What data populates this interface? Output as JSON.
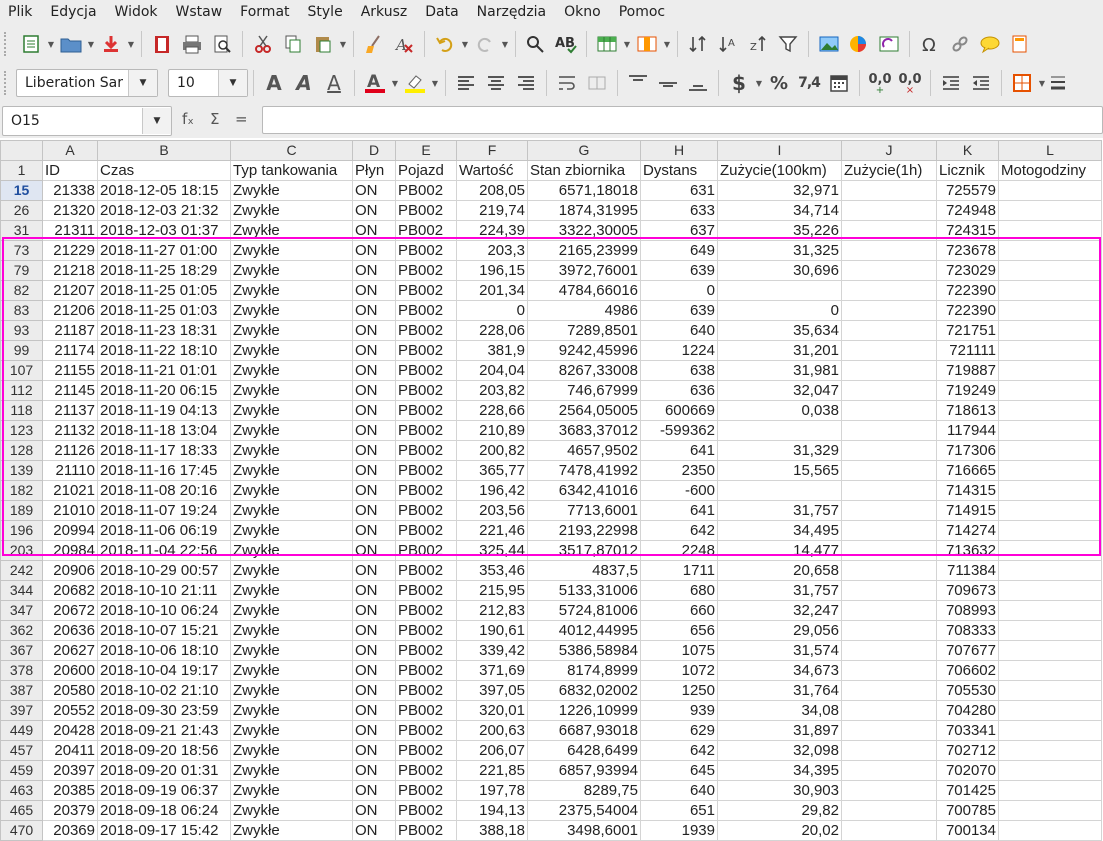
{
  "menu": [
    "Plik",
    "Edycja",
    "Widok",
    "Wstaw",
    "Format",
    "Style",
    "Arkusz",
    "Data",
    "Narzędzia",
    "Okno",
    "Pomoc"
  ],
  "font_name": "Liberation Sar",
  "font_size": "10",
  "name_box": "O15",
  "formula_icons": {
    "fx": "fₓ",
    "sigma": "Σ",
    "eq": "="
  },
  "toolbar_text": {
    "bold": "A",
    "italic": "A",
    "shadow": "A",
    "currency": "$",
    "percent": "%",
    "number": "7,4",
    "add_dec": "0,0",
    "del_dec": "0,0"
  },
  "columns": [
    "A",
    "B",
    "C",
    "D",
    "E",
    "F",
    "G",
    "H",
    "I",
    "J",
    "K",
    "L"
  ],
  "header_row": {
    "num": "1",
    "cells": [
      "ID",
      "Czas",
      "Typ tankowania",
      "Płyn",
      "Pojazd",
      "Wartość",
      "Stan zbiornika",
      "Dystans",
      "Zużycie(100km)",
      "Zużycie(1h)",
      "Licznik",
      "Motogodziny"
    ]
  },
  "rows": [
    {
      "num": "15",
      "cells": [
        "21338",
        "2018-12-05 18:15",
        "Zwykłe",
        "ON",
        "PB002",
        "208,05",
        "6571,18018",
        "631",
        "32,971",
        "",
        "725579",
        ""
      ]
    },
    {
      "num": "26",
      "cells": [
        "21320",
        "2018-12-03 21:32",
        "Zwykłe",
        "ON",
        "PB002",
        "219,74",
        "1874,31995",
        "633",
        "34,714",
        "",
        "724948",
        ""
      ]
    },
    {
      "num": "31",
      "cells": [
        "21311",
        "2018-12-03 01:37",
        "Zwykłe",
        "ON",
        "PB002",
        "224,39",
        "3322,30005",
        "637",
        "35,226",
        "",
        "724315",
        ""
      ]
    },
    {
      "num": "73",
      "cells": [
        "21229",
        "2018-11-27 01:00",
        "Zwykłe",
        "ON",
        "PB002",
        "203,3",
        "2165,23999",
        "649",
        "31,325",
        "",
        "723678",
        ""
      ]
    },
    {
      "num": "79",
      "cells": [
        "21218",
        "2018-11-25 18:29",
        "Zwykłe",
        "ON",
        "PB002",
        "196,15",
        "3972,76001",
        "639",
        "30,696",
        "",
        "723029",
        ""
      ]
    },
    {
      "num": "82",
      "cells": [
        "21207",
        "2018-11-25 01:05",
        "Zwykłe",
        "ON",
        "PB002",
        "201,34",
        "4784,66016",
        "0",
        "",
        "",
        "722390",
        ""
      ]
    },
    {
      "num": "83",
      "cells": [
        "21206",
        "2018-11-25 01:03",
        "Zwykłe",
        "ON",
        "PB002",
        "0",
        "4986",
        "639",
        "0",
        "",
        "722390",
        ""
      ]
    },
    {
      "num": "93",
      "cells": [
        "21187",
        "2018-11-23 18:31",
        "Zwykłe",
        "ON",
        "PB002",
        "228,06",
        "7289,8501",
        "640",
        "35,634",
        "",
        "721751",
        ""
      ]
    },
    {
      "num": "99",
      "cells": [
        "21174",
        "2018-11-22 18:10",
        "Zwykłe",
        "ON",
        "PB002",
        "381,9",
        "9242,45996",
        "1224",
        "31,201",
        "",
        "721111",
        ""
      ]
    },
    {
      "num": "107",
      "cells": [
        "21155",
        "2018-11-21 01:01",
        "Zwykłe",
        "ON",
        "PB002",
        "204,04",
        "8267,33008",
        "638",
        "31,981",
        "",
        "719887",
        ""
      ]
    },
    {
      "num": "112",
      "cells": [
        "21145",
        "2018-11-20 06:15",
        "Zwykłe",
        "ON",
        "PB002",
        "203,82",
        "746,67999",
        "636",
        "32,047",
        "",
        "719249",
        ""
      ]
    },
    {
      "num": "118",
      "cells": [
        "21137",
        "2018-11-19 04:13",
        "Zwykłe",
        "ON",
        "PB002",
        "228,66",
        "2564,05005",
        "600669",
        "0,038",
        "",
        "718613",
        ""
      ]
    },
    {
      "num": "123",
      "cells": [
        "21132",
        "2018-11-18 13:04",
        "Zwykłe",
        "ON",
        "PB002",
        "210,89",
        "3683,37012",
        "-599362",
        "",
        "",
        "117944",
        ""
      ]
    },
    {
      "num": "128",
      "cells": [
        "21126",
        "2018-11-17 18:33",
        "Zwykłe",
        "ON",
        "PB002",
        "200,82",
        "4657,9502",
        "641",
        "31,329",
        "",
        "717306",
        ""
      ]
    },
    {
      "num": "139",
      "cells": [
        "21110",
        "2018-11-16 17:45",
        "Zwykłe",
        "ON",
        "PB002",
        "365,77",
        "7478,41992",
        "2350",
        "15,565",
        "",
        "716665",
        ""
      ]
    },
    {
      "num": "182",
      "cells": [
        "21021",
        "2018-11-08 20:16",
        "Zwykłe",
        "ON",
        "PB002",
        "196,42",
        "6342,41016",
        "-600",
        "",
        "",
        "714315",
        ""
      ]
    },
    {
      "num": "189",
      "cells": [
        "21010",
        "2018-11-07 19:24",
        "Zwykłe",
        "ON",
        "PB002",
        "203,56",
        "7713,6001",
        "641",
        "31,757",
        "",
        "714915",
        ""
      ]
    },
    {
      "num": "196",
      "cells": [
        "20994",
        "2018-11-06 06:19",
        "Zwykłe",
        "ON",
        "PB002",
        "221,46",
        "2193,22998",
        "642",
        "34,495",
        "",
        "714274",
        ""
      ]
    },
    {
      "num": "203",
      "cells": [
        "20984",
        "2018-11-04 22:56",
        "Zwykłe",
        "ON",
        "PB002",
        "325,44",
        "3517,87012",
        "2248",
        "14,477",
        "",
        "713632",
        ""
      ]
    },
    {
      "num": "242",
      "cells": [
        "20906",
        "2018-10-29 00:57",
        "Zwykłe",
        "ON",
        "PB002",
        "353,46",
        "4837,5",
        "1711",
        "20,658",
        "",
        "711384",
        ""
      ]
    },
    {
      "num": "344",
      "cells": [
        "20682",
        "2018-10-10 21:11",
        "Zwykłe",
        "ON",
        "PB002",
        "215,95",
        "5133,31006",
        "680",
        "31,757",
        "",
        "709673",
        ""
      ]
    },
    {
      "num": "347",
      "cells": [
        "20672",
        "2018-10-10 06:24",
        "Zwykłe",
        "ON",
        "PB002",
        "212,83",
        "5724,81006",
        "660",
        "32,247",
        "",
        "708993",
        ""
      ]
    },
    {
      "num": "362",
      "cells": [
        "20636",
        "2018-10-07 15:21",
        "Zwykłe",
        "ON",
        "PB002",
        "190,61",
        "4012,44995",
        "656",
        "29,056",
        "",
        "708333",
        ""
      ]
    },
    {
      "num": "367",
      "cells": [
        "20627",
        "2018-10-06 18:10",
        "Zwykłe",
        "ON",
        "PB002",
        "339,42",
        "5386,58984",
        "1075",
        "31,574",
        "",
        "707677",
        ""
      ]
    },
    {
      "num": "378",
      "cells": [
        "20600",
        "2018-10-04 19:17",
        "Zwykłe",
        "ON",
        "PB002",
        "371,69",
        "8174,8999",
        "1072",
        "34,673",
        "",
        "706602",
        ""
      ]
    },
    {
      "num": "387",
      "cells": [
        "20580",
        "2018-10-02 21:10",
        "Zwykłe",
        "ON",
        "PB002",
        "397,05",
        "6832,02002",
        "1250",
        "31,764",
        "",
        "705530",
        ""
      ]
    },
    {
      "num": "397",
      "cells": [
        "20552",
        "2018-09-30 23:59",
        "Zwykłe",
        "ON",
        "PB002",
        "320,01",
        "1226,10999",
        "939",
        "34,08",
        "",
        "704280",
        ""
      ]
    },
    {
      "num": "449",
      "cells": [
        "20428",
        "2018-09-21 21:43",
        "Zwykłe",
        "ON",
        "PB002",
        "200,63",
        "6687,93018",
        "629",
        "31,897",
        "",
        "703341",
        ""
      ]
    },
    {
      "num": "457",
      "cells": [
        "20411",
        "2018-09-20 18:56",
        "Zwykłe",
        "ON",
        "PB002",
        "206,07",
        "6428,6499",
        "642",
        "32,098",
        "",
        "702712",
        ""
      ]
    },
    {
      "num": "459",
      "cells": [
        "20397",
        "2018-09-20 01:31",
        "Zwykłe",
        "ON",
        "PB002",
        "221,85",
        "6857,93994",
        "645",
        "34,395",
        "",
        "702070",
        ""
      ]
    },
    {
      "num": "463",
      "cells": [
        "20385",
        "2018-09-19 06:37",
        "Zwykłe",
        "ON",
        "PB002",
        "197,78",
        "8289,75",
        "640",
        "30,903",
        "",
        "701425",
        ""
      ]
    },
    {
      "num": "465",
      "cells": [
        "20379",
        "2018-09-18 06:24",
        "Zwykłe",
        "ON",
        "PB002",
        "194,13",
        "2375,54004",
        "651",
        "29,82",
        "",
        "700785",
        ""
      ]
    },
    {
      "num": "470",
      "cells": [
        "20369",
        "2018-09-17 15:42",
        "Zwykłe",
        "ON",
        "PB002",
        "388,18",
        "3498,6001",
        "1939",
        "20,02",
        "",
        "700134",
        ""
      ]
    }
  ],
  "colors": {
    "highlight": "#ff00d8",
    "toolbar_bg": "#ededed",
    "selected_row_header": "#1f4e9e"
  }
}
